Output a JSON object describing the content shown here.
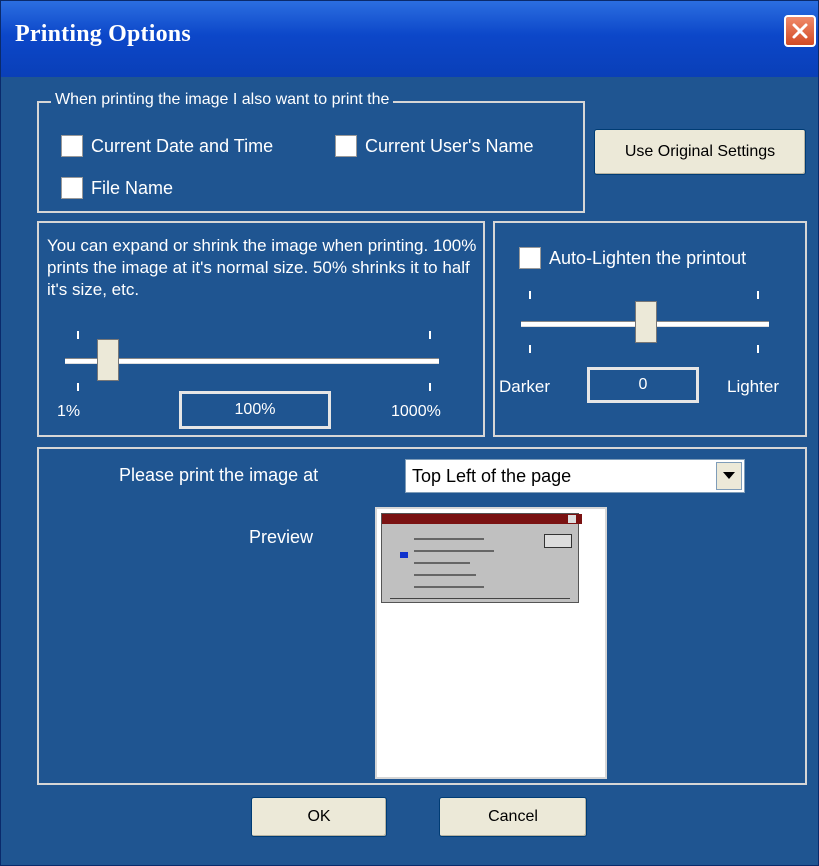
{
  "window": {
    "title": "Printing Options",
    "close_icon": "close-icon"
  },
  "print_extras": {
    "legend": "When printing the image I also want to print the",
    "checkbox_date_label": "Current Date and Time",
    "checkbox_user_label": "Current User's Name",
    "checkbox_file_label": "File Name",
    "use_original_settings_label": "Use Original Settings"
  },
  "scale": {
    "description": "You can expand or shrink the image when printing.  100% prints the image at it's normal size.  50% shrinks it to half it's size, etc.",
    "min_label": "1%",
    "max_label": "1000%",
    "value_label": "100%"
  },
  "lighten": {
    "checkbox_label": "Auto-Lighten the printout",
    "darker_label": "Darker",
    "lighter_label": "Lighter",
    "value_label": "0"
  },
  "placement": {
    "prompt_label": "Please print the image at",
    "selected": "Top Left of the page",
    "preview_label": "Preview"
  },
  "buttons": {
    "ok_label": "OK",
    "cancel_label": "Cancel"
  },
  "colors": {
    "dialog_background": "#1f5591",
    "titlebar": "#0c47c9",
    "close_button": "#d24a24"
  }
}
